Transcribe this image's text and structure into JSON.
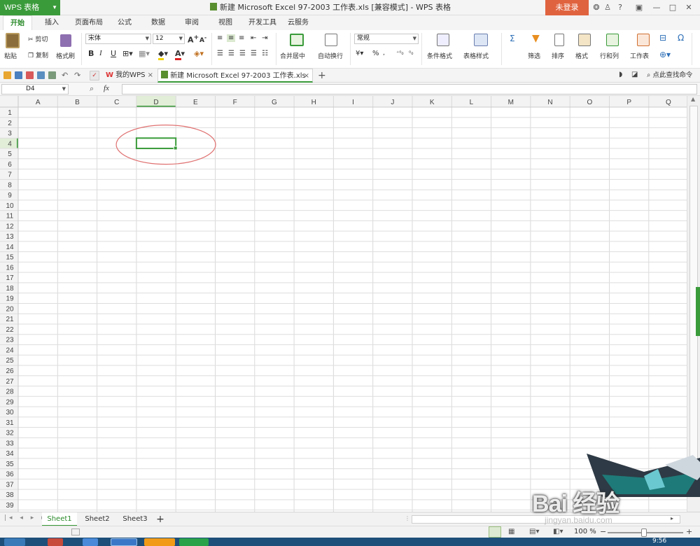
{
  "titlebar": {
    "app_menu_label": "WPS 表格",
    "doc_title": "新建 Microsoft Excel 97-2003 工作表.xls [兼容模式] - WPS 表格",
    "login_label": "未登录",
    "help_label": "?"
  },
  "menu_tabs": [
    "开始",
    "插入",
    "页面布局",
    "公式",
    "数据",
    "审阅",
    "视图",
    "开发工具",
    "云服务"
  ],
  "ribbon": {
    "paste": "粘贴",
    "cut": "剪切",
    "copy": "复制",
    "format_painter": "格式刷",
    "font_name": "宋体",
    "font_size": "12",
    "bold": "B",
    "italic": "I",
    "underline": "U",
    "merge_center": "合并居中",
    "wrap_text": "自动换行",
    "number_format": "常规",
    "percent": "%",
    "conditional_format": "条件格式",
    "table_style": "表格样式",
    "sum": "Σ",
    "filter": "筛选",
    "sort": "排序",
    "format": "格式",
    "row_col": "行和列",
    "worksheet": "工作表",
    "symbol": "Ω"
  },
  "doc_tabs": [
    {
      "label": "我的WPS",
      "close": "×"
    },
    {
      "label": "新建 Microsoft Excel 97-2003 工作表.xls",
      "close": "×"
    }
  ],
  "search_command": "点此查找命令",
  "formula_bar": {
    "name_box": "D4",
    "fx": "fx",
    "formula": ""
  },
  "grid": {
    "columns": [
      "A",
      "B",
      "C",
      "D",
      "E",
      "F",
      "G",
      "H",
      "I",
      "J",
      "K",
      "L",
      "M",
      "N",
      "O",
      "P",
      "Q"
    ],
    "rows": [
      "1",
      "2",
      "3",
      "4",
      "5",
      "6",
      "7",
      "8",
      "9",
      "10",
      "11",
      "12",
      "13",
      "14",
      "15",
      "16",
      "17",
      "18",
      "19",
      "20",
      "21",
      "22",
      "23",
      "24",
      "25",
      "26",
      "27",
      "28",
      "29",
      "30",
      "31",
      "32",
      "33",
      "34",
      "35",
      "36",
      "37",
      "38",
      "39"
    ],
    "selected_cell": "D4",
    "accent": "#3a9b3a",
    "annotation_color": "#e07070"
  },
  "sheets": [
    "Sheet1",
    "Sheet2",
    "Sheet3"
  ],
  "active_sheet": "Sheet1",
  "add_sheet": "+",
  "status": {
    "zoom": "100 %",
    "zoom_minus": "−",
    "zoom_plus": "+"
  },
  "taskbar": {
    "clock": "9:56"
  },
  "watermark": {
    "logo": "Bai 经验",
    "url": "jingyan.baidu.com"
  }
}
